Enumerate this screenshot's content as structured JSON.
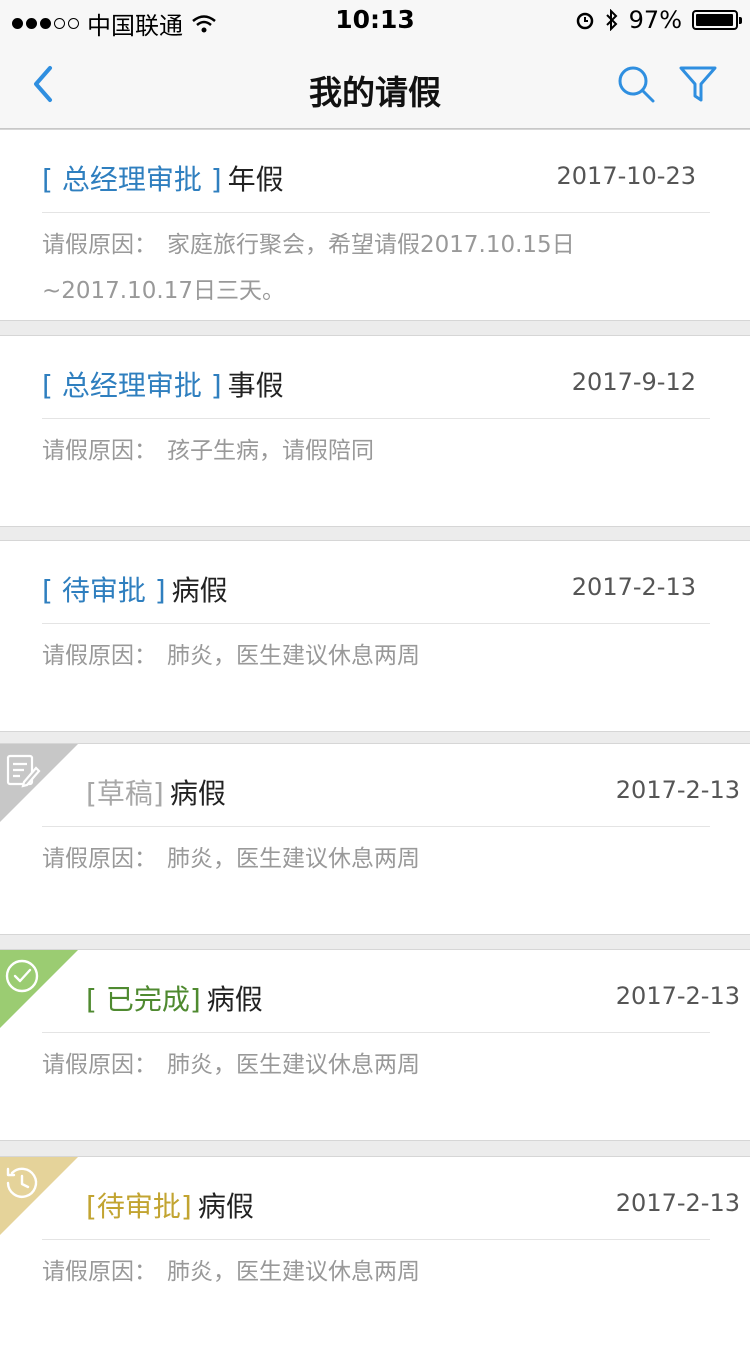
{
  "status_bar": {
    "carrier": "中国联通",
    "time": "10:13",
    "battery": "97%",
    "battery_level": 0.97
  },
  "nav": {
    "title": "我的请假"
  },
  "colors": {
    "blue": "#2f7fbf",
    "draft": "#b0b0b0",
    "done": "#5b9e3c",
    "pending": "#c9a93b",
    "draft_corner": "#c7c7c7",
    "done_corner": "#9bcc72",
    "pending_corner": "#e5d39a"
  },
  "reason_label": "请假原因：",
  "items": [
    {
      "status": "[ 总经理审批 ]",
      "type": "年假",
      "date": "2017-10-23",
      "reason": "家庭旅行聚会，希望请假2017.10.15日~2017.10.17日三天。",
      "status_color": "#2f7fbf",
      "corner": "none"
    },
    {
      "status": "[ 总经理审批 ]",
      "type": "事假",
      "date": "2017-9-12",
      "reason": "孩子生病，请假陪同",
      "status_color": "#2f7fbf",
      "corner": "none"
    },
    {
      "status": "[ 待审批 ]",
      "type": "病假",
      "date": "2017-2-13",
      "reason": "肺炎，医生建议休息两周",
      "status_color": "#2f7fbf",
      "corner": "none"
    },
    {
      "status": "[草稿]",
      "type": "病假",
      "date": "2017-2-13",
      "reason": "肺炎，医生建议休息两周",
      "status_color": "#a8a8a8",
      "corner": "edit-icon"
    },
    {
      "status": "[ 已完成]",
      "type": "病假",
      "date": "2017-2-13",
      "reason": "肺炎，医生建议休息两周",
      "status_color": "#4f8a30",
      "corner": "check-circle-icon"
    },
    {
      "status": "[待审批]",
      "type": "病假",
      "date": "2017-2-13",
      "reason": "肺炎，医生建议休息两周",
      "status_color": "#c2a431",
      "corner": "clock-icon"
    }
  ]
}
